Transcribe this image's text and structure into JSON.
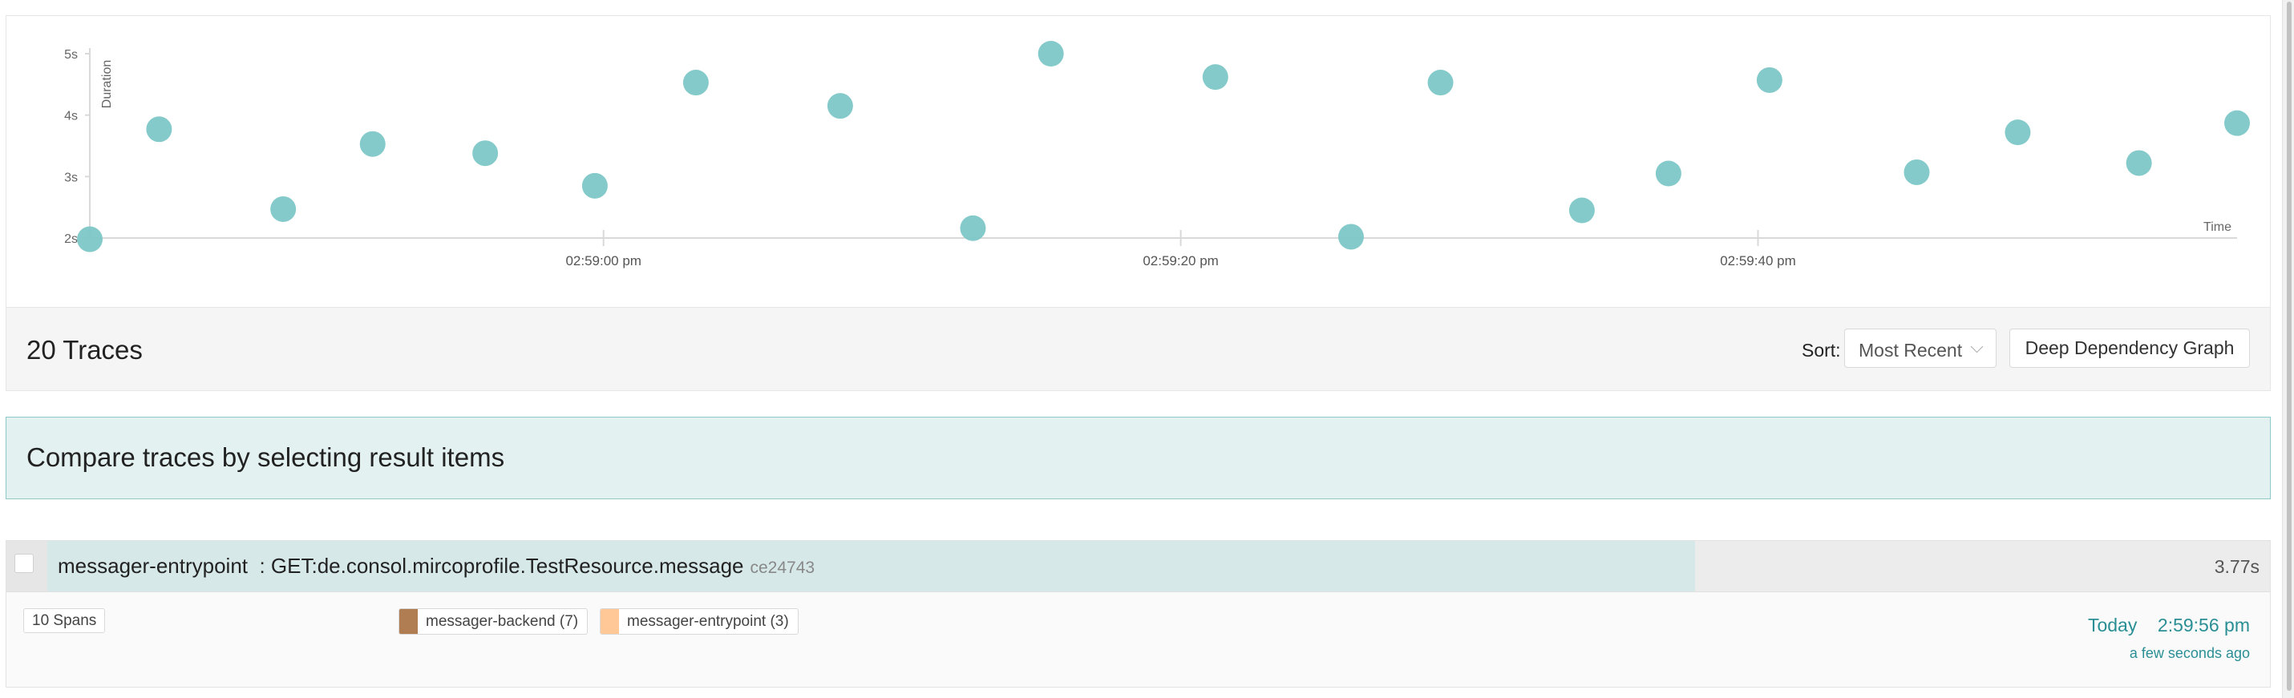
{
  "chart_data": {
    "type": "scatter",
    "ylabel": "Duration",
    "xlabel": "Time",
    "y_ticks": [
      "2s",
      "3s",
      "4s",
      "5s"
    ],
    "x_ticks": [
      {
        "label": "02:59:00 pm",
        "t": 0
      },
      {
        "label": "02:59:20 pm",
        "t": 20
      },
      {
        "label": "02:59:40 pm",
        "t": 40
      }
    ],
    "xlim": [
      -17.8,
      56.6
    ],
    "ylim": [
      2,
      5
    ],
    "point_color": "#7ec7c7",
    "points": [
      {
        "t": -17.8,
        "y": 1.98
      },
      {
        "t": -15.4,
        "y": 3.77
      },
      {
        "t": -11.1,
        "y": 2.47
      },
      {
        "t": -8.0,
        "y": 3.53
      },
      {
        "t": -4.1,
        "y": 3.38
      },
      {
        "t": -0.3,
        "y": 2.85
      },
      {
        "t": 3.2,
        "y": 4.53
      },
      {
        "t": 8.2,
        "y": 4.15
      },
      {
        "t": 12.8,
        "y": 2.16
      },
      {
        "t": 15.5,
        "y": 5.0
      },
      {
        "t": 21.2,
        "y": 4.62
      },
      {
        "t": 25.9,
        "y": 2.02
      },
      {
        "t": 29.0,
        "y": 4.53
      },
      {
        "t": 33.9,
        "y": 2.45
      },
      {
        "t": 36.9,
        "y": 3.05
      },
      {
        "t": 40.4,
        "y": 4.57
      },
      {
        "t": 45.5,
        "y": 3.07
      },
      {
        "t": 49.0,
        "y": 3.72
      },
      {
        "t": 53.2,
        "y": 3.22
      },
      {
        "t": 56.6,
        "y": 3.87
      }
    ]
  },
  "results": {
    "count_label": "20 Traces",
    "sort_label": "Sort:",
    "sort_value": "Most Recent",
    "ddg_label": "Deep Dependency Graph"
  },
  "compare": {
    "text": "Compare traces by selecting result items"
  },
  "trace": {
    "service": "messager-entrypoint",
    "separator": ": ",
    "operation": "GET:de.consol.mircoprofile.TestResource.message",
    "id": "ce24743",
    "duration": "3.77s",
    "duration_fraction": 0.746,
    "spans": "10 Spans",
    "services": [
      {
        "label": "messager-backend (7)",
        "color": "#b07d52"
      },
      {
        "label": "messager-entrypoint (3)",
        "color": "#ffc896"
      }
    ],
    "date": "Today",
    "time": "2:59:56 pm",
    "relative": "a few seconds ago"
  }
}
